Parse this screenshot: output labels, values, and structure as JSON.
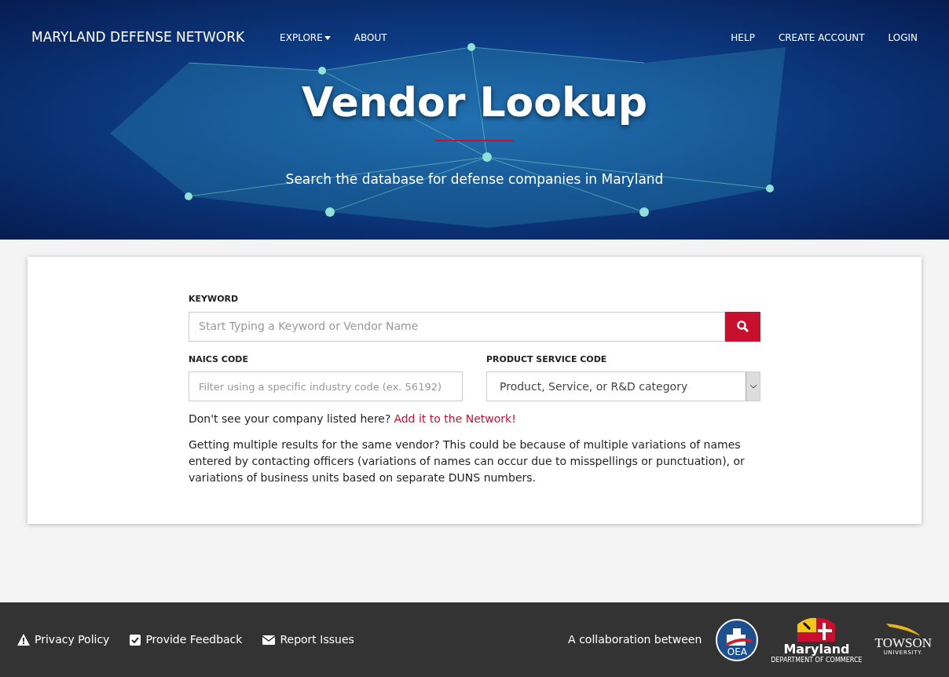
{
  "navbar": {
    "brand": "MARYLAND DEFENSE NETWORK",
    "left_items": [
      {
        "label": "EXPLORE",
        "dropdown": true
      },
      {
        "label": "ABOUT",
        "dropdown": false
      }
    ],
    "right_items": [
      {
        "label": "HELP"
      },
      {
        "label": "CREATE ACCOUNT"
      },
      {
        "label": "LOGIN"
      }
    ]
  },
  "hero": {
    "title": "Vendor Lookup",
    "subtitle": "Search the database for defense companies in Maryland"
  },
  "search_form": {
    "keyword": {
      "label": "KEYWORD",
      "placeholder": "Start Typing a Keyword or Vendor Name"
    },
    "naics": {
      "label": "NAICS CODE",
      "placeholder": "Filter using a specific industry code (ex. 56192)"
    },
    "product_service": {
      "label": "PRODUCT SERVICE CODE",
      "value": "Product, Service, or R&D category"
    },
    "add_prompt": {
      "text": "Don't see your company listed here?",
      "link": "Add it to the Network!"
    },
    "note": "Getting multiple results for the same vendor? This could be because of multiple variations of names entered by contacting officers (variations of names can occur due to misspellings or punctuation), or variations of business units based on separate DUNS numbers."
  },
  "footer": {
    "links": [
      {
        "kind": "warning",
        "label": "Privacy Policy"
      },
      {
        "kind": "check",
        "label": "Provide Feedback"
      },
      {
        "kind": "mail",
        "label": "Report Issues"
      }
    ],
    "collaboration_text": "A collaboration between",
    "logos": [
      {
        "kind": "oea",
        "text": "OEA"
      },
      {
        "kind": "maryland",
        "text": "Maryland",
        "subtext": "DEPARTMENT OF COMMERCE"
      },
      {
        "kind": "towson",
        "text": "TOWSON",
        "subtext": "UNIVERSITY."
      }
    ]
  }
}
